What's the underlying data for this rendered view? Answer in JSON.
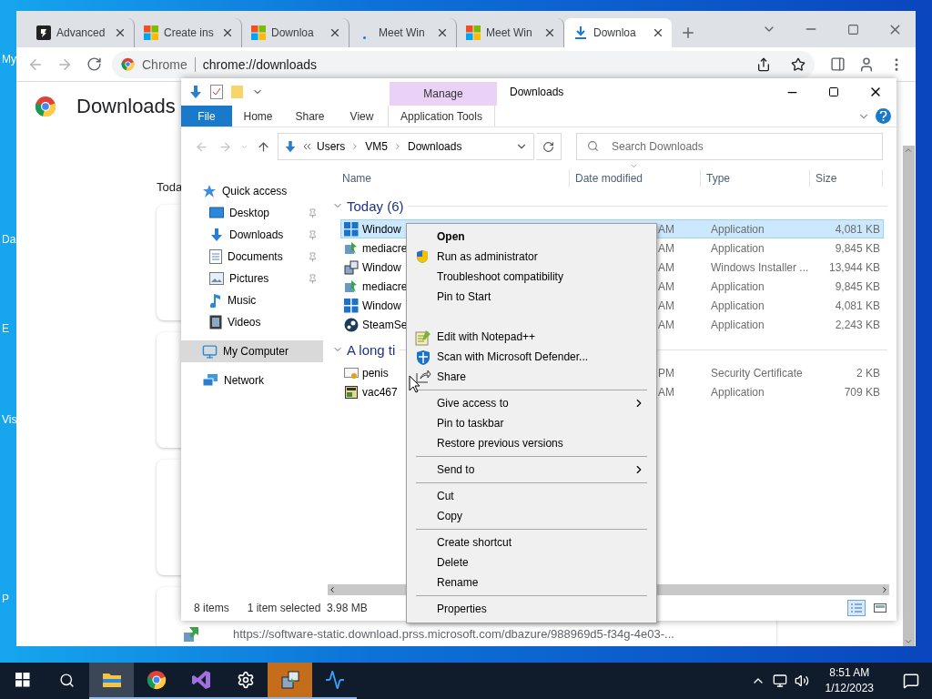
{
  "desktop_icons": [
    {
      "label": "My"
    },
    {
      "label": "Da"
    },
    {
      "label": "E"
    },
    {
      "label": "Vis"
    },
    {
      "label": "P"
    }
  ],
  "browser": {
    "tabs": [
      {
        "title": "Advanced",
        "selected": false
      },
      {
        "title": "Create ins",
        "selected": false
      },
      {
        "title": "Downloa",
        "selected": false
      },
      {
        "title": "Meet Win",
        "selected": false
      },
      {
        "title": "Meet Win",
        "selected": false
      },
      {
        "title": "Downloa",
        "selected": true
      }
    ],
    "omnibox": {
      "site": "Chrome",
      "url": "chrome://downloads"
    },
    "page": {
      "title": "Downloads",
      "section": "Toda",
      "download_url": "https://software-static.download.prss.microsoft.com/dbazure/988969d5-f34g-4e03-..."
    }
  },
  "explorer": {
    "contextual_tab": "Manage",
    "title": "Downloads",
    "ribbon_tabs": [
      {
        "label": "File",
        "kind": "file"
      },
      {
        "label": "Home",
        "kind": "tab"
      },
      {
        "label": "Share",
        "kind": "tab"
      },
      {
        "label": "View",
        "kind": "tab"
      },
      {
        "label": "Application Tools",
        "kind": "contextual"
      }
    ],
    "breadcrumb": [
      "Users",
      "VM5",
      "Downloads"
    ],
    "search": {
      "placeholder": "Search Downloads"
    },
    "nav": [
      {
        "label": "Quick access",
        "selected": false,
        "children": [
          {
            "label": "Desktop",
            "pinned": true,
            "selected": false
          },
          {
            "label": "Downloads",
            "pinned": true,
            "selected": false
          },
          {
            "label": "Documents",
            "pinned": true,
            "selected": false
          },
          {
            "label": "Pictures",
            "pinned": true,
            "selected": false
          },
          {
            "label": "Music",
            "pinned": false,
            "selected": false
          },
          {
            "label": "Videos",
            "pinned": false,
            "selected": false
          }
        ]
      },
      {
        "label": "My Computer",
        "selected": true
      },
      {
        "label": "Network",
        "selected": false
      }
    ],
    "columns": [
      "Name",
      "Date modified",
      "Type",
      "Size"
    ],
    "groups": [
      {
        "title": "Today (6)",
        "expanded": true,
        "files": [
          {
            "name": "Window",
            "date": "AM",
            "type": "Application",
            "size": "4,081 KB",
            "selected": true
          },
          {
            "name": "mediacre",
            "date": "AM",
            "type": "Application",
            "size": "9,845 KB",
            "selected": false
          },
          {
            "name": "Window",
            "date": "AM",
            "type": "Windows Installer ...",
            "size": "13,944 KB",
            "selected": false
          },
          {
            "name": "mediacre",
            "date": "AM",
            "type": "Application",
            "size": "9,845 KB",
            "selected": false
          },
          {
            "name": "Window",
            "date": "AM",
            "type": "Application",
            "size": "4,081 KB",
            "selected": false
          },
          {
            "name": "SteamSe",
            "date": "AM",
            "type": "Application",
            "size": "2,243 KB",
            "selected": false
          }
        ]
      },
      {
        "title": "A long ti",
        "expanded": true,
        "files": [
          {
            "name": "penis",
            "date": "PM",
            "type": "Security Certificate",
            "size": "2 KB",
            "selected": false
          },
          {
            "name": "vac467",
            "date": "AM",
            "type": "Application",
            "size": "709 KB",
            "selected": false
          }
        ]
      }
    ],
    "status": {
      "count": "8 items",
      "selection": "1 item selected",
      "size": "3.98 MB"
    }
  },
  "context_menu": {
    "groups": [
      {
        "separator": false,
        "items": [
          {
            "label": "Open",
            "default": true,
            "submenu": false
          },
          {
            "label": "Run as administrator",
            "default": false,
            "submenu": false
          },
          {
            "label": "Troubleshoot compatibility",
            "default": false,
            "submenu": false
          },
          {
            "label": "Pin to Start",
            "default": false,
            "submenu": false
          }
        ]
      },
      {
        "separator": false,
        "items": [
          {
            "label": "Edit with Notepad++",
            "default": false,
            "submenu": false
          },
          {
            "label": "Scan with Microsoft Defender...",
            "default": false,
            "submenu": false
          },
          {
            "label": "Share",
            "default": false,
            "submenu": false
          }
        ]
      },
      {
        "separator": true,
        "items": [
          {
            "label": "Give access to",
            "default": false,
            "submenu": true
          },
          {
            "label": "Pin to taskbar",
            "default": false,
            "submenu": false
          },
          {
            "label": "Restore previous versions",
            "default": false,
            "submenu": false
          }
        ]
      },
      {
        "separator": true,
        "items": [
          {
            "label": "Send to",
            "default": false,
            "submenu": true
          }
        ]
      },
      {
        "separator": true,
        "items": [
          {
            "label": "Cut",
            "default": false,
            "submenu": false
          },
          {
            "label": "Copy",
            "default": false,
            "submenu": false
          }
        ]
      },
      {
        "separator": true,
        "items": [
          {
            "label": "Create shortcut",
            "default": false,
            "submenu": false
          },
          {
            "label": "Delete",
            "default": false,
            "submenu": false
          },
          {
            "label": "Rename",
            "default": false,
            "submenu": false
          }
        ]
      },
      {
        "separator": true,
        "items": [
          {
            "label": "Properties",
            "default": false,
            "submenu": false
          }
        ]
      }
    ]
  },
  "taskbar": {
    "apps": [
      {
        "active": true,
        "running": true,
        "flashing": false
      },
      {
        "active": false,
        "running": true,
        "flashing": false
      },
      {
        "active": false,
        "running": true,
        "flashing": false
      },
      {
        "active": false,
        "running": true,
        "flashing": false
      },
      {
        "active": false,
        "running": true,
        "flashing": true
      },
      {
        "active": false,
        "running": true,
        "flashing": false
      }
    ],
    "clock": {
      "time": "8:51 AM",
      "date": "1/12/2023"
    }
  }
}
